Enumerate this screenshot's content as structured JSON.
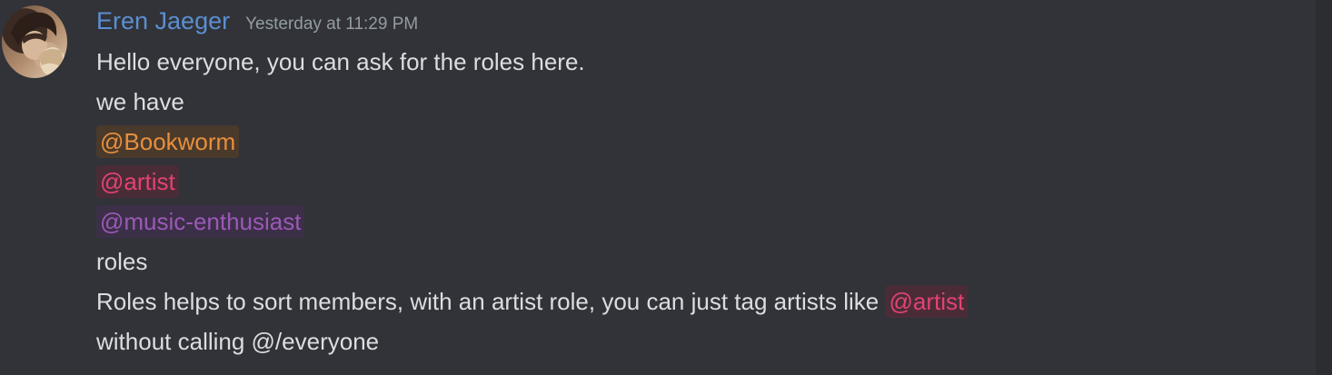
{
  "message": {
    "author": "Eren Jaeger",
    "timestamp": "Yesterday at 11:29 PM",
    "avatar_icon": "user-avatar-icon",
    "author_color": "#5b8fd1",
    "lines": {
      "line1": "Hello everyone, you can ask for the roles here.",
      "line2": "we have",
      "line6": "roles",
      "line7_prefix": "Roles helps to sort members, with an artist role, you can just tag artists like ",
      "line8": "without calling @/everyone"
    },
    "mentions": {
      "bookworm": {
        "label": "@Bookworm",
        "color": "#e88f3c",
        "bg": "#4a3a2c"
      },
      "artist": {
        "label": "@artist",
        "color": "#e24373",
        "bg": "#4a2c37"
      },
      "music": {
        "label": "@music-enthusiast",
        "color": "#9b59b6",
        "bg": "#3c2f48"
      },
      "artist_inline": {
        "label": "@artist",
        "color": "#e24373",
        "bg": "#4a2c37"
      }
    }
  }
}
